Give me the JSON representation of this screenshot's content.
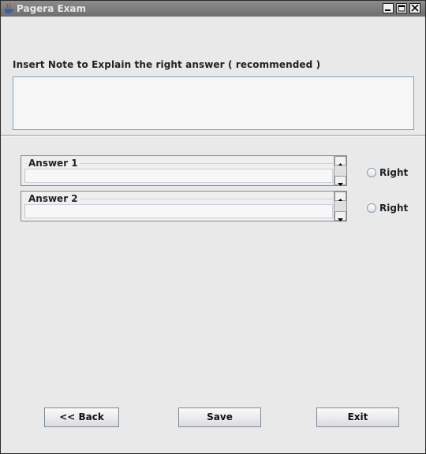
{
  "window": {
    "title": "Pagera Exam",
    "app_icon": "java-cup-icon",
    "controls": [
      "minimize-icon",
      "maximize-icon",
      "close-icon"
    ]
  },
  "note": {
    "label": "Insert Note to Explain the right answer ( recommended )",
    "value": ""
  },
  "answers": [
    {
      "title": "Answer  1",
      "value": "",
      "radio_label": "Right",
      "selected": false
    },
    {
      "title": "Answer  2",
      "value": "",
      "radio_label": "Right",
      "selected": false
    }
  ],
  "buttons": {
    "back": "<< Back",
    "save": "Save",
    "exit": "Exit"
  },
  "colors": {
    "titlebar": "#7a7a7a",
    "background": "#e9e9e9",
    "field_border": "#7f9db9"
  }
}
